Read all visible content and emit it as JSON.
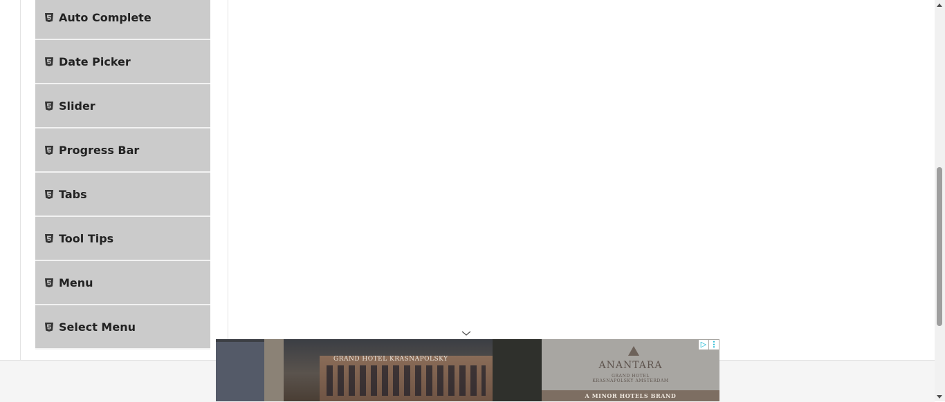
{
  "sidebar": {
    "items": [
      {
        "label": "Auto Complete",
        "icon": "html5-icon"
      },
      {
        "label": "Date Picker",
        "icon": "html5-icon"
      },
      {
        "label": "Slider",
        "icon": "html5-icon"
      },
      {
        "label": "Progress Bar",
        "icon": "html5-icon"
      },
      {
        "label": "Tabs",
        "icon": "html5-icon"
      },
      {
        "label": "Tool Tips",
        "icon": "html5-icon"
      },
      {
        "label": "Menu",
        "icon": "html5-icon"
      },
      {
        "label": "Select Menu",
        "icon": "html5-icon"
      }
    ]
  },
  "ad": {
    "hotel_sign": "GRAND HOTEL KRASNAPOLSKY",
    "brand_name": "ANANTARA",
    "brand_sub1": "GRAND HOTEL",
    "brand_sub2": "KRASNAPOLSKY AMSTERDAM",
    "tagline": "A MINOR HOTELS BRAND",
    "adchoices_icon": "adchoices-icon",
    "menu_icon": "vertical-dots-icon"
  },
  "colors": {
    "menu_item_bg": "#cbcbcb",
    "menu_item_text": "#222222",
    "footer_bg": "#f5f5f5",
    "ad_accent": "#00aecd"
  }
}
